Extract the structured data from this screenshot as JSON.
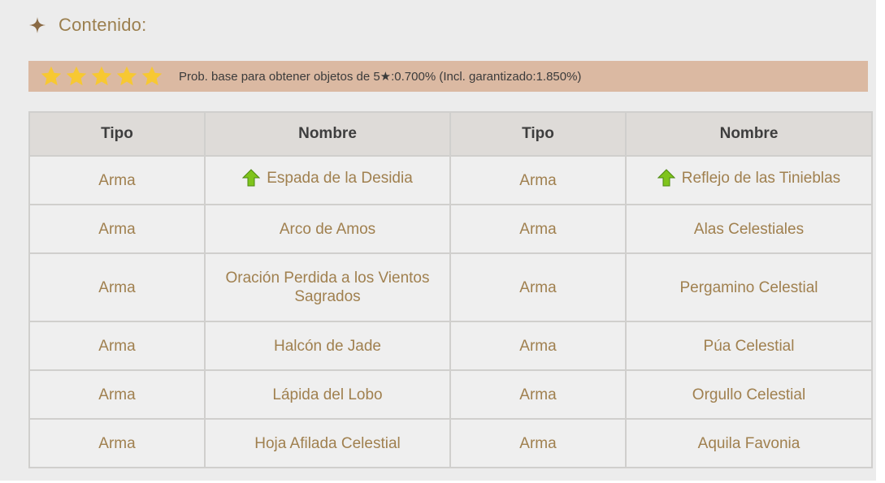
{
  "section": {
    "title": "Contenido:",
    "icon": "sparkle-icon",
    "icon_color": "#8a6a44"
  },
  "rate": {
    "star_count": 5,
    "star_color": "#f7c832",
    "text": "Prob. base para obtener objetos de 5★:0.700% (Incl. garantizado:1.850%)"
  },
  "table": {
    "headers": [
      "Tipo",
      "Nombre",
      "Tipo",
      "Nombre"
    ],
    "rows": [
      {
        "tipo1": "Arma",
        "nombre1": "Espada de la Desidia",
        "featured1": true,
        "tipo2": "Arma",
        "nombre2": "Reflejo de las Tinieblas",
        "featured2": true
      },
      {
        "tipo1": "Arma",
        "nombre1": "Arco de Amos",
        "featured1": false,
        "tipo2": "Arma",
        "nombre2": "Alas Celestiales",
        "featured2": false
      },
      {
        "tipo1": "Arma",
        "nombre1": "Oración Perdida a los Vientos Sagrados",
        "featured1": false,
        "tipo2": "Arma",
        "nombre2": "Pergamino Celestial",
        "featured2": false
      },
      {
        "tipo1": "Arma",
        "nombre1": "Halcón de Jade",
        "featured1": false,
        "tipo2": "Arma",
        "nombre2": "Púa Celestial",
        "featured2": false
      },
      {
        "tipo1": "Arma",
        "nombre1": "Lápida del Lobo",
        "featured1": false,
        "tipo2": "Arma",
        "nombre2": "Orgullo Celestial",
        "featured2": false
      },
      {
        "tipo1": "Arma",
        "nombre1": "Hoja Afilada Celestial",
        "featured1": false,
        "tipo2": "Arma",
        "nombre2": "Aquila Favonia",
        "featured2": false
      }
    ]
  },
  "colors": {
    "accent_text": "#a0804f",
    "rate_bar": "#dbb9a2",
    "featured_arrow": "#7fc41c"
  }
}
